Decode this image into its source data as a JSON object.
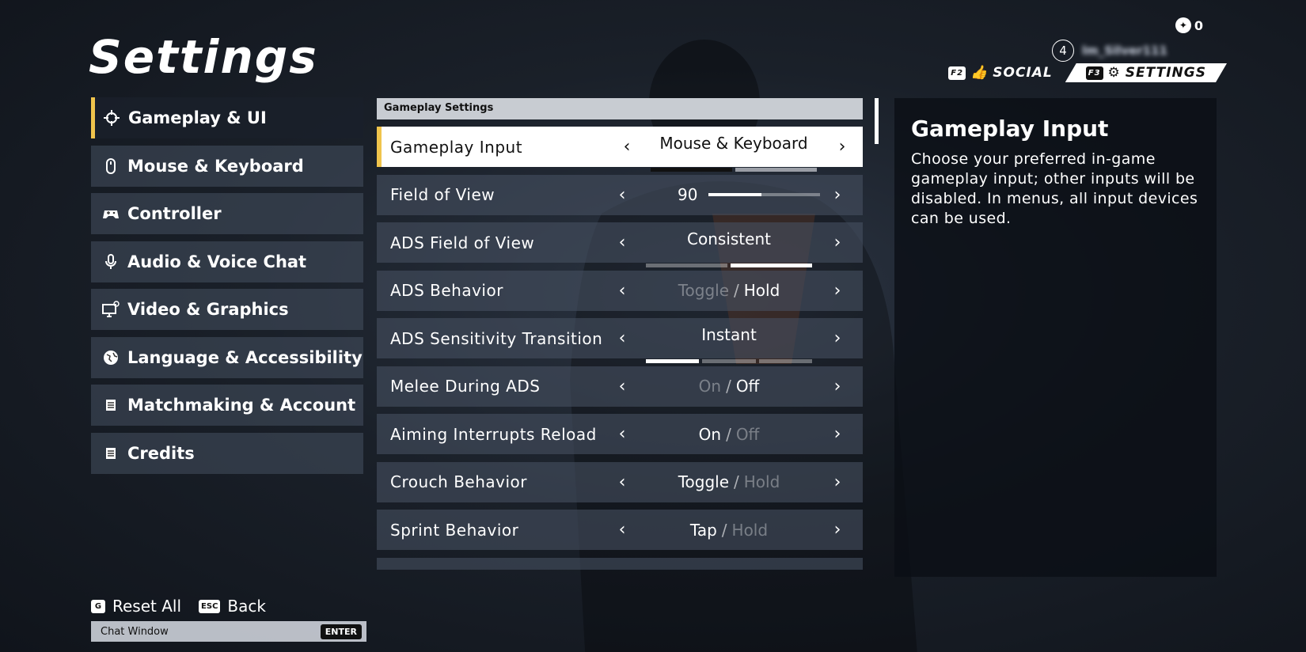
{
  "title": "Settings",
  "header": {
    "currency_value": "0",
    "player_level": "4",
    "player_name": "lm_Silver111",
    "tabs": [
      {
        "key": "F2",
        "label": "SOCIAL"
      },
      {
        "key": "F3",
        "label": "SETTINGS"
      }
    ]
  },
  "nav": {
    "items": [
      {
        "label": "Gameplay & UI",
        "icon": "crosshair-icon"
      },
      {
        "label": "Mouse & Keyboard",
        "icon": "mouse-icon"
      },
      {
        "label": "Controller",
        "icon": "gamepad-icon"
      },
      {
        "label": "Audio & Voice Chat",
        "icon": "microphone-icon"
      },
      {
        "label": "Video & Graphics",
        "icon": "monitor-gear-icon"
      },
      {
        "label": "Language & Accessibility",
        "icon": "globe-icon"
      },
      {
        "label": "Matchmaking & Account",
        "icon": "list-icon"
      },
      {
        "label": "Credits",
        "icon": "list-icon"
      }
    ]
  },
  "section_header": "Gameplay Settings",
  "settings": [
    {
      "label": "Gameplay Input",
      "value": "Mouse & Keyboard",
      "segments": 2,
      "selected_segment": 1
    },
    {
      "label": "Field of View",
      "value": "90",
      "slider_fraction": 0.47
    },
    {
      "label": "ADS Field of View",
      "value": "Consistent",
      "segments": 2,
      "selected_segment": 2
    },
    {
      "label": "ADS Behavior",
      "option_a": "Toggle",
      "option_b": "Hold",
      "selected": "b"
    },
    {
      "label": "ADS Sensitivity Transition",
      "value": "Instant",
      "segments": 3,
      "selected_segment": 1
    },
    {
      "label": "Melee During ADS",
      "option_a": "On",
      "option_b": "Off",
      "selected": "b"
    },
    {
      "label": "Aiming Interrupts Reload",
      "option_a": "On",
      "option_b": "Off",
      "selected": "a"
    },
    {
      "label": "Crouch Behavior",
      "option_a": "Toggle",
      "option_b": "Hold",
      "selected": "a"
    },
    {
      "label": "Sprint Behavior",
      "option_a": "Tap",
      "option_b": "Hold",
      "selected": "a"
    }
  ],
  "option_separator": "/",
  "description": {
    "title": "Gameplay Input",
    "text": "Choose your preferred in-game gameplay input; other inputs will be disabled. In menus, all input devices can be used."
  },
  "bottom": {
    "reset_key": "G",
    "reset_label": "Reset All",
    "back_key": "ESC",
    "back_label": "Back",
    "chat_label": "Chat Window",
    "chat_key": "ENTER"
  },
  "colors": {
    "accent": "#f0c44c",
    "panel": "#46505f",
    "active_row": "#ffffff"
  }
}
